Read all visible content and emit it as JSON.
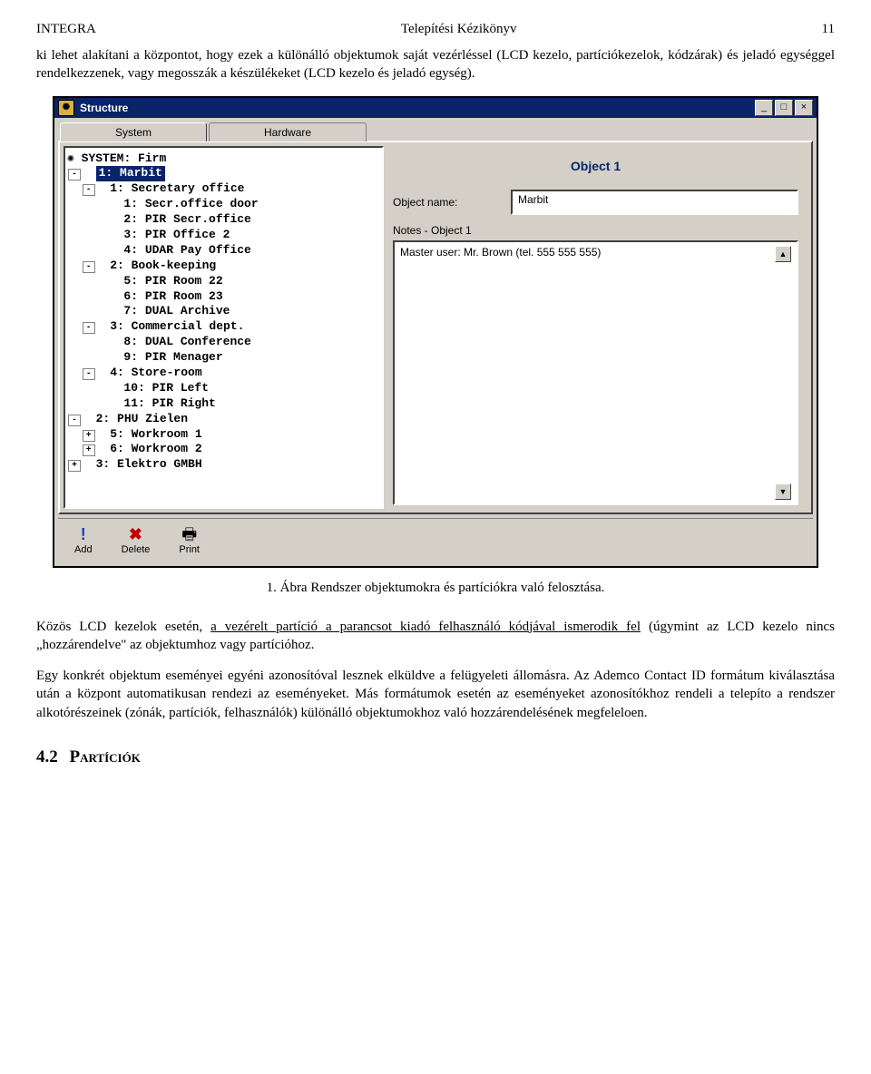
{
  "header": {
    "left": "INTEGRA",
    "center": "Telepítési Kézikönyv",
    "right": "11"
  },
  "para1": "ki lehet alakítani a központot, hogy ezek a különálló objektumok saját vezérléssel (LCD kezelo, partíciókezelok, kódzárak) és jeladó egységgel rendelkezzenek, vagy megosszák a készülékeket (LCD kezelo és jeladó egység).",
  "caption": "1. Ábra Rendszer objektumokra és partíciókra való felosztása.",
  "para2a": "Közös LCD kezelok esetén, ",
  "para2u": "a vezérelt partíció a parancsot kiadó felhasználó kódjával ismerodik fel",
  "para2b": " (úgymint az LCD kezelo nincs „hozzárendelve\" az objektumhoz vagy partícióhoz.",
  "para3": "Egy konkrét objektum eseményei egyéni azonosítóval lesznek elküldve a felügyeleti állomásra. Az Ademco Contact ID formátum kiválasztása után a központ automatikusan rendezi az eseményeket. Más formátumok esetén az eseményeket azonosítókhoz rendeli a telepíto a rendszer alkotórészeinek (zónák, partíciók, felhasználók) különálló objektumokhoz való hozzárendelésének megfeleloen.",
  "section": {
    "num": "4.2",
    "title": "Partíciók"
  },
  "window": {
    "title": "Structure",
    "tabs": {
      "system": "System",
      "hardware": "Hardware"
    },
    "right": {
      "heading": "Object 1",
      "name_label": "Object name:",
      "name_value": "Marbit",
      "notes_label": "Notes - Object 1",
      "notes_value": "Master user: Mr. Brown (tel. 555 555 555)"
    },
    "toolbar": {
      "add": "Add",
      "delete": "Delete",
      "print": "Print"
    },
    "tree": {
      "root": "SYSTEM: Firm",
      "n1": "1: Marbit",
      "n1_1": "1: Secretary office",
      "n1_1_1": "1: Secr.office door",
      "n1_1_2": "2: PIR Secr.office",
      "n1_1_3": "3: PIR Office 2",
      "n1_1_4": "4: UDAR Pay Office",
      "n1_2": "2: Book-keeping",
      "n1_2_5": "5: PIR Room 22",
      "n1_2_6": "6: PIR Room 23",
      "n1_2_7": "7: DUAL Archive",
      "n1_3": "3: Commercial dept.",
      "n1_3_8": "8: DUAL Conference",
      "n1_3_9": "9: PIR Menager",
      "n1_4": "4: Store-room",
      "n1_4_10": "10: PIR Left",
      "n1_4_11": "11: PIR Right",
      "n2": "2: PHU Zielen",
      "n2_5": "5: Workroom 1",
      "n2_6": "6: Workroom 2",
      "n3": "3: Elektro GMBH"
    }
  }
}
